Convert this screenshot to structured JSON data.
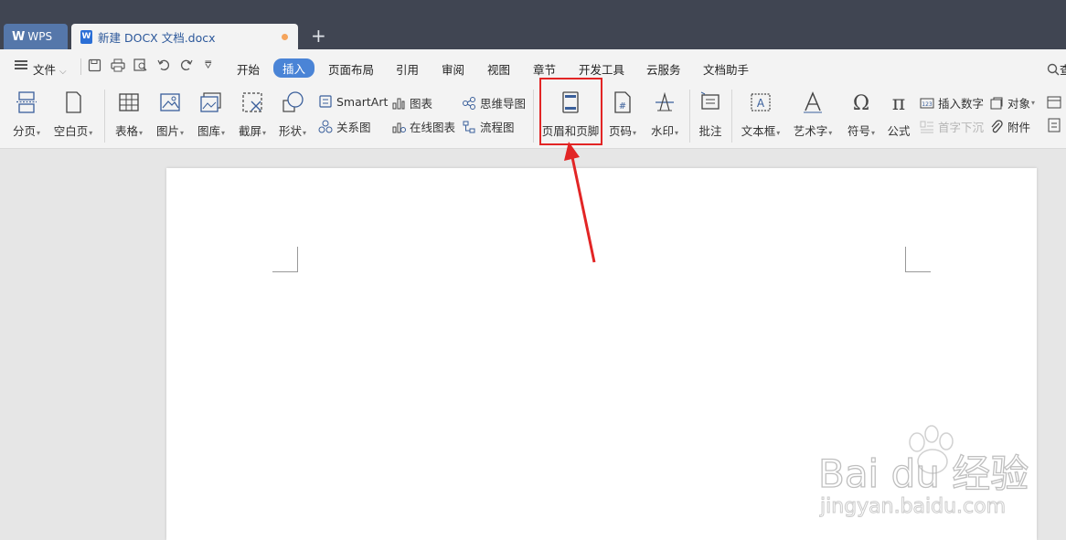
{
  "titlebar": {
    "wps_tab": "WPS",
    "doc_tab": "新建 DOCX 文档.docx",
    "new_tab": "+"
  },
  "menubar": {
    "file": "文件",
    "items": [
      "开始",
      "插入",
      "页面布局",
      "引用",
      "审阅",
      "视图",
      "章节",
      "开发工具",
      "云服务",
      "文档助手"
    ],
    "active": "插入",
    "search_glyph": "查"
  },
  "ribbon": {
    "page_break": "分页",
    "blank_page": "空白页",
    "table": "表格",
    "picture": "图片",
    "gallery": "图库",
    "screenshot": "截屏",
    "shape": "形状",
    "smartart": "SmartArt",
    "chart": "图表",
    "mindmap": "思维导图",
    "relation": "关系图",
    "online_chart": "在线图表",
    "flowchart": "流程图",
    "header_footer": "页眉和页脚",
    "page_number": "页码",
    "watermark": "水印",
    "comment": "批注",
    "textbox": "文本框",
    "wordart": "艺术字",
    "symbol": "符号",
    "formula": "公式",
    "insert_number": "插入数字",
    "object": "对象",
    "drop_cap": "首字下沉",
    "attachment": "附件"
  },
  "watermark": {
    "brand": "Bai du 经验",
    "url": "jingyan.baidu.com"
  },
  "colors": {
    "titlebar": "#404552",
    "accent": "#4a84d6",
    "highlight": "#e22525"
  }
}
